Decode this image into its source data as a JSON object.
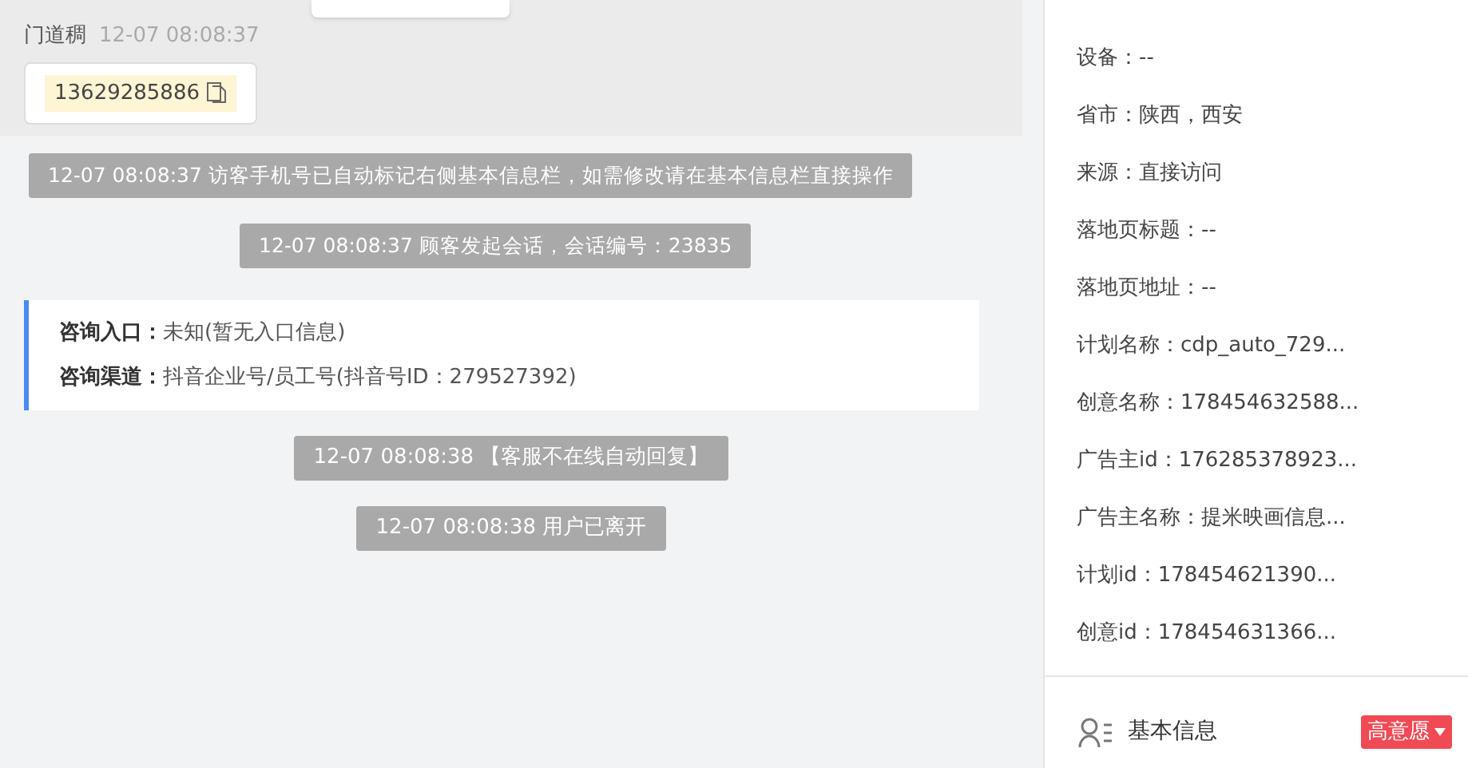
{
  "message": {
    "sender": "门道稠",
    "time": "12-07 08:08:37",
    "phone": "13629285886"
  },
  "system_before": [
    "12-07 08:08:37 访客手机号已自动标记右侧基本信息栏，如需修改请在基本信息栏直接操作",
    "12-07 08:08:37 顾客发起会话，会话编号：23835"
  ],
  "consult": [
    {
      "label": "咨询入口：",
      "value": "未知(暂无入口信息)"
    },
    {
      "label": "咨询渠道：",
      "value": "抖音企业号/员工号(抖音号ID：279527392)"
    }
  ],
  "system_after": [
    "12-07 08:08:38 【客服不在线自动回复】",
    "12-07 08:08:38 用户已离开"
  ],
  "source_info": [
    "设备：--",
    "省市：陕西，西安",
    "来源：直接访问",
    "落地页标题：--",
    "落地页地址：--",
    "计划名称：cdp_auto_729...",
    "创意名称：178454632588...",
    "广告主id：176285378923...",
    "广告主名称：提米映画信息...",
    "计划id：178454621390...",
    "创意id：178454631366..."
  ],
  "basic_info": {
    "title": "基本信息",
    "intent": "高意愿"
  }
}
